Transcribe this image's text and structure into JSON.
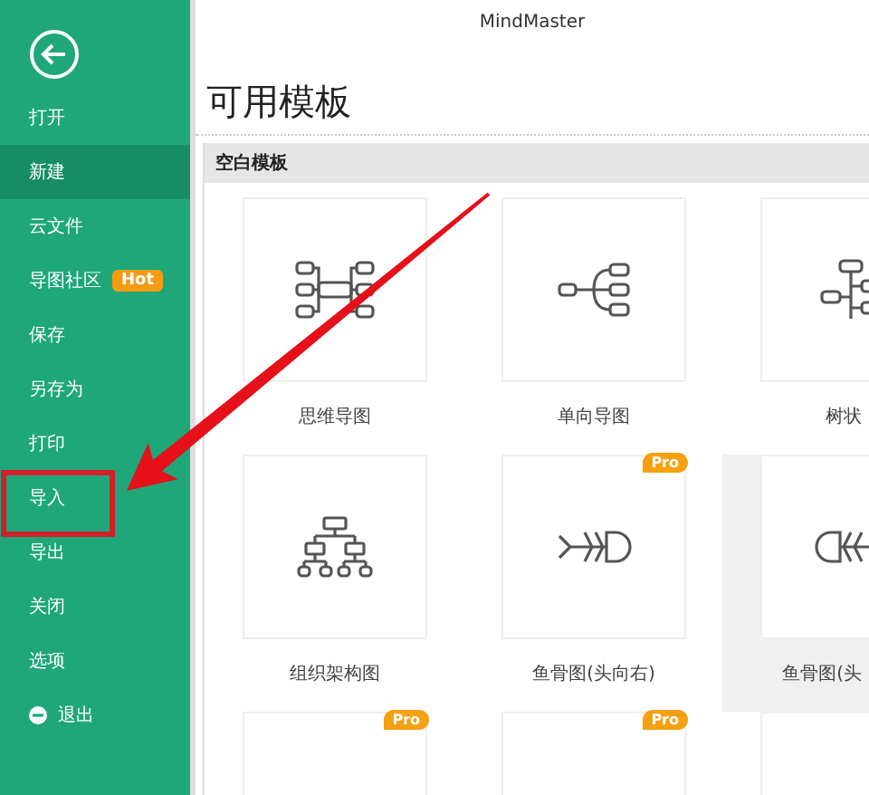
{
  "window": {
    "title": "MindMaster"
  },
  "sidebar": {
    "items": [
      {
        "label": "打开",
        "kind": "text",
        "selected": false,
        "highlighted": false
      },
      {
        "label": "新建",
        "kind": "text",
        "selected": true,
        "highlighted": false
      },
      {
        "label": "云文件",
        "kind": "text",
        "selected": false,
        "highlighted": false
      },
      {
        "label": "导图社区",
        "kind": "text",
        "selected": false,
        "highlighted": false,
        "badge": "Hot"
      },
      {
        "label": "保存",
        "kind": "text",
        "selected": false,
        "highlighted": false
      },
      {
        "label": "另存为",
        "kind": "text",
        "selected": false,
        "highlighted": false
      },
      {
        "label": "打印",
        "kind": "text",
        "selected": false,
        "highlighted": false
      },
      {
        "label": "导入",
        "kind": "text",
        "selected": false,
        "highlighted": true
      },
      {
        "label": "导出",
        "kind": "text",
        "selected": false,
        "highlighted": false
      },
      {
        "label": "关闭",
        "kind": "text",
        "selected": false,
        "highlighted": false
      },
      {
        "label": "选项",
        "kind": "text",
        "selected": false,
        "highlighted": false
      },
      {
        "label": "退出",
        "kind": "exit",
        "selected": false,
        "highlighted": false
      }
    ]
  },
  "heading": "可用模板",
  "section": {
    "title": "空白模板",
    "templates": [
      {
        "kind": "mindmap",
        "label": "思维导图",
        "pro": false,
        "hovered": false
      },
      {
        "kind": "rightmap",
        "label": "单向导图",
        "pro": false,
        "hovered": false
      },
      {
        "kind": "tree",
        "label": "树状",
        "pro": false,
        "hovered": false
      },
      {
        "kind": "org",
        "label": "组织架构图",
        "pro": false,
        "hovered": false
      },
      {
        "kind": "fish-right",
        "label": "鱼骨图(头向右)",
        "pro": true,
        "proLabel": "Pro",
        "hovered": false
      },
      {
        "kind": "fish-left",
        "label": "鱼骨图(头",
        "pro": false,
        "hovered": true
      },
      {
        "kind": "blank",
        "pro": true,
        "proLabel": "Pro",
        "hovered": false
      },
      {
        "kind": "blank",
        "pro": true,
        "proLabel": "Pro",
        "hovered": false
      },
      {
        "kind": "blank",
        "pro": false,
        "hovered": false
      }
    ]
  }
}
